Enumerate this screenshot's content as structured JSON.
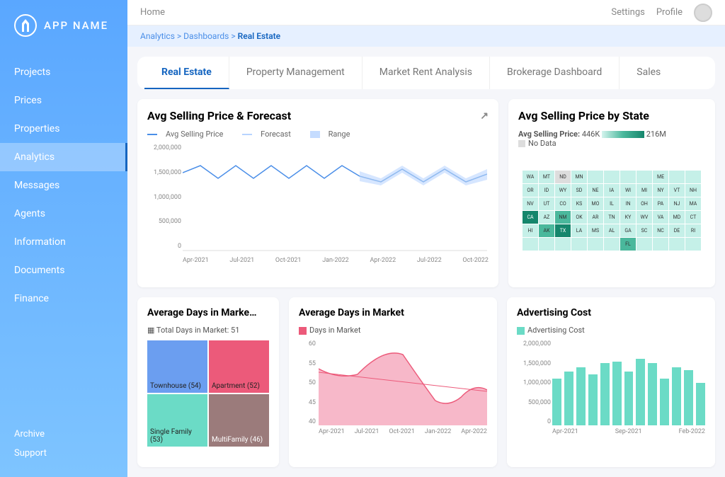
{
  "app_name": "APP NAME",
  "topbar": {
    "home": "Home",
    "settings": "Settings",
    "profile": "Profile"
  },
  "breadcrumb": {
    "a": "Analytics",
    "b": "Dashboards",
    "c": "Real Estate"
  },
  "sidebar": {
    "items": [
      "Projects",
      "Prices",
      "Properties",
      "Analytics",
      "Messages",
      "Agents",
      "Information",
      "Documents",
      "Finance"
    ],
    "active": 3,
    "bottom": [
      "Archive",
      "Support"
    ]
  },
  "tabs": {
    "items": [
      "Real Estate",
      "Property Management",
      "Market Rent Analysis",
      "Brokerage Dashboard",
      "Sales"
    ],
    "active": 0
  },
  "card1": {
    "title": "Avg Selling Price & Forecast",
    "legend": {
      "a": "Avg Selling Price",
      "b": "Forecast",
      "c": "Range"
    }
  },
  "card2": {
    "title": "Avg Selling Price by State",
    "label": "Avg Selling Price:",
    "min": "446K",
    "max": "216M",
    "nodata": "No Data"
  },
  "card3": {
    "title": "Average Days in Marke…",
    "sub": "Total Days in Market: 51"
  },
  "card4": {
    "title": "Average Days in Market",
    "legend": "Days in Market"
  },
  "card5": {
    "title": "Advertising Cost",
    "legend": "Advertising Cost"
  },
  "chart_data": [
    {
      "type": "line",
      "title": "Avg Selling Price & Forecast",
      "series": [
        {
          "name": "Avg Selling Price",
          "x": [
            "Apr-2021",
            "Jul-2021",
            "Oct-2021",
            "Jan-2022"
          ],
          "values": [
            1500000,
            1550000,
            1580000,
            1600000
          ]
        },
        {
          "name": "Forecast",
          "x": [
            "Apr-2022",
            "Jul-2022",
            "Oct-2022"
          ],
          "values": [
            1600000,
            1620000,
            1650000
          ]
        }
      ],
      "ylim": [
        0,
        2000000
      ],
      "yticks": [
        0,
        500000,
        1000000,
        1500000,
        2000000
      ],
      "xticks": [
        "Apr-2021",
        "Jul-2021",
        "Oct-2021",
        "Jan-2022",
        "Apr-2022",
        "Jul-2022",
        "Oct-2022"
      ]
    },
    {
      "type": "treemap",
      "title": "Average Days in Market by Type",
      "total": 51,
      "items": [
        {
          "name": "Townhouse",
          "value": 54
        },
        {
          "name": "Apartment",
          "value": 52
        },
        {
          "name": "Single Family",
          "value": 53
        },
        {
          "name": "MultiFamily",
          "value": 46
        }
      ]
    },
    {
      "type": "area",
      "title": "Average Days in Market",
      "x": [
        "Apr-2021",
        "Jul-2021",
        "Oct-2021",
        "Jan-2022",
        "Apr-2022"
      ],
      "values": [
        53,
        52,
        57,
        47,
        49
      ],
      "ylim": [
        40,
        60
      ],
      "yticks": [
        40,
        45,
        50,
        55,
        60
      ]
    },
    {
      "type": "bar",
      "title": "Advertising Cost",
      "x": [
        "Apr-2021",
        "May-2021",
        "Jun-2021",
        "Jul-2021",
        "Aug-2021",
        "Sep-2021",
        "Oct-2021",
        "Nov-2021",
        "Dec-2021",
        "Jan-2022",
        "Feb-2022",
        "Mar-2022",
        "Apr-2022"
      ],
      "values": [
        1100000,
        1250000,
        1350000,
        1200000,
        1450000,
        1500000,
        1250000,
        1550000,
        1450000,
        1100000,
        1350000,
        1300000,
        1000000
      ],
      "ylim": [
        0,
        2000000
      ],
      "yticks": [
        0,
        500000,
        1000000,
        1500000,
        2000000
      ],
      "xticks": [
        "Apr-2021",
        "Sep-2021",
        "Feb-2022"
      ]
    },
    {
      "type": "choropleth",
      "title": "Avg Selling Price by State",
      "range": [
        "446K",
        "216M"
      ],
      "states": [
        "WA",
        "MT",
        "ND",
        "MN",
        "OR",
        "ID",
        "WY",
        "SD",
        "NE",
        "IA",
        "WI",
        "MI",
        "NV",
        "UT",
        "CO",
        "KS",
        "MO",
        "IL",
        "IN",
        "OH",
        "PA",
        "NY",
        "CA",
        "AZ",
        "NM",
        "OK",
        "AR",
        "TN",
        "KY",
        "WV",
        "VA",
        "MD",
        "NJ",
        "TX",
        "LA",
        "MS",
        "AL",
        "GA",
        "SC",
        "NC",
        "FL",
        "HI",
        "AK",
        "NH",
        "MA",
        "CT",
        "RI",
        "DE",
        "ME",
        "VT"
      ]
    }
  ],
  "treemap_labels": {
    "a": "Townhouse (54)",
    "b": "Apartment (52)",
    "c": "Single Family (53)",
    "d": "MultiFamily (46)"
  }
}
